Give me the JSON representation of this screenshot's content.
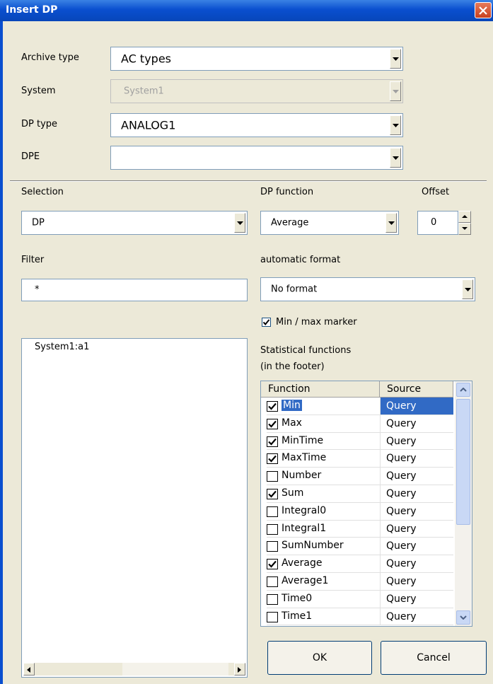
{
  "window": {
    "title": "Insert DP"
  },
  "archive_type": {
    "label": "Archive type",
    "value": "AC types"
  },
  "system": {
    "label": "System",
    "value": "System1"
  },
  "dp_type": {
    "label": "DP type",
    "value": "ANALOG1"
  },
  "dpe": {
    "label": "DPE",
    "value": ""
  },
  "selection": {
    "label": "Selection",
    "value": "DP"
  },
  "dp_function": {
    "label": "DP function",
    "value": "Average"
  },
  "offset": {
    "label": "Offset",
    "value": "0"
  },
  "filter": {
    "label": "Filter",
    "value": "*"
  },
  "auto_format": {
    "label": "automatic format",
    "value": "No format"
  },
  "min_max_marker": {
    "label": "Min / max marker",
    "checked": true
  },
  "dp_list": {
    "items": [
      "System1:a1"
    ]
  },
  "stat_functions": {
    "label_line1": "Statistical functions",
    "label_line2": "(in the footer)",
    "columns": [
      "Function",
      "Source"
    ],
    "rows": [
      {
        "name": "Min",
        "source": "Query",
        "checked": true,
        "selected": true
      },
      {
        "name": "Max",
        "source": "Query",
        "checked": true
      },
      {
        "name": "MinTime",
        "source": "Query",
        "checked": true
      },
      {
        "name": "MaxTime",
        "source": "Query",
        "checked": true
      },
      {
        "name": "Number",
        "source": "Query",
        "checked": false
      },
      {
        "name": "Sum",
        "source": "Query",
        "checked": true
      },
      {
        "name": "Integral0",
        "source": "Query",
        "checked": false
      },
      {
        "name": "Integral1",
        "source": "Query",
        "checked": false
      },
      {
        "name": "SumNumber",
        "source": "Query",
        "checked": false
      },
      {
        "name": "Average",
        "source": "Query",
        "checked": true
      },
      {
        "name": "Average1",
        "source": "Query",
        "checked": false
      },
      {
        "name": "Time0",
        "source": "Query",
        "checked": false
      },
      {
        "name": "Time1",
        "source": "Query",
        "checked": false
      }
    ]
  },
  "buttons": {
    "ok": "OK",
    "cancel": "Cancel"
  },
  "colors": {
    "title_bar": "#0a4fcf",
    "selection": "#316ac5",
    "dialog_bg": "#ece9d8"
  }
}
